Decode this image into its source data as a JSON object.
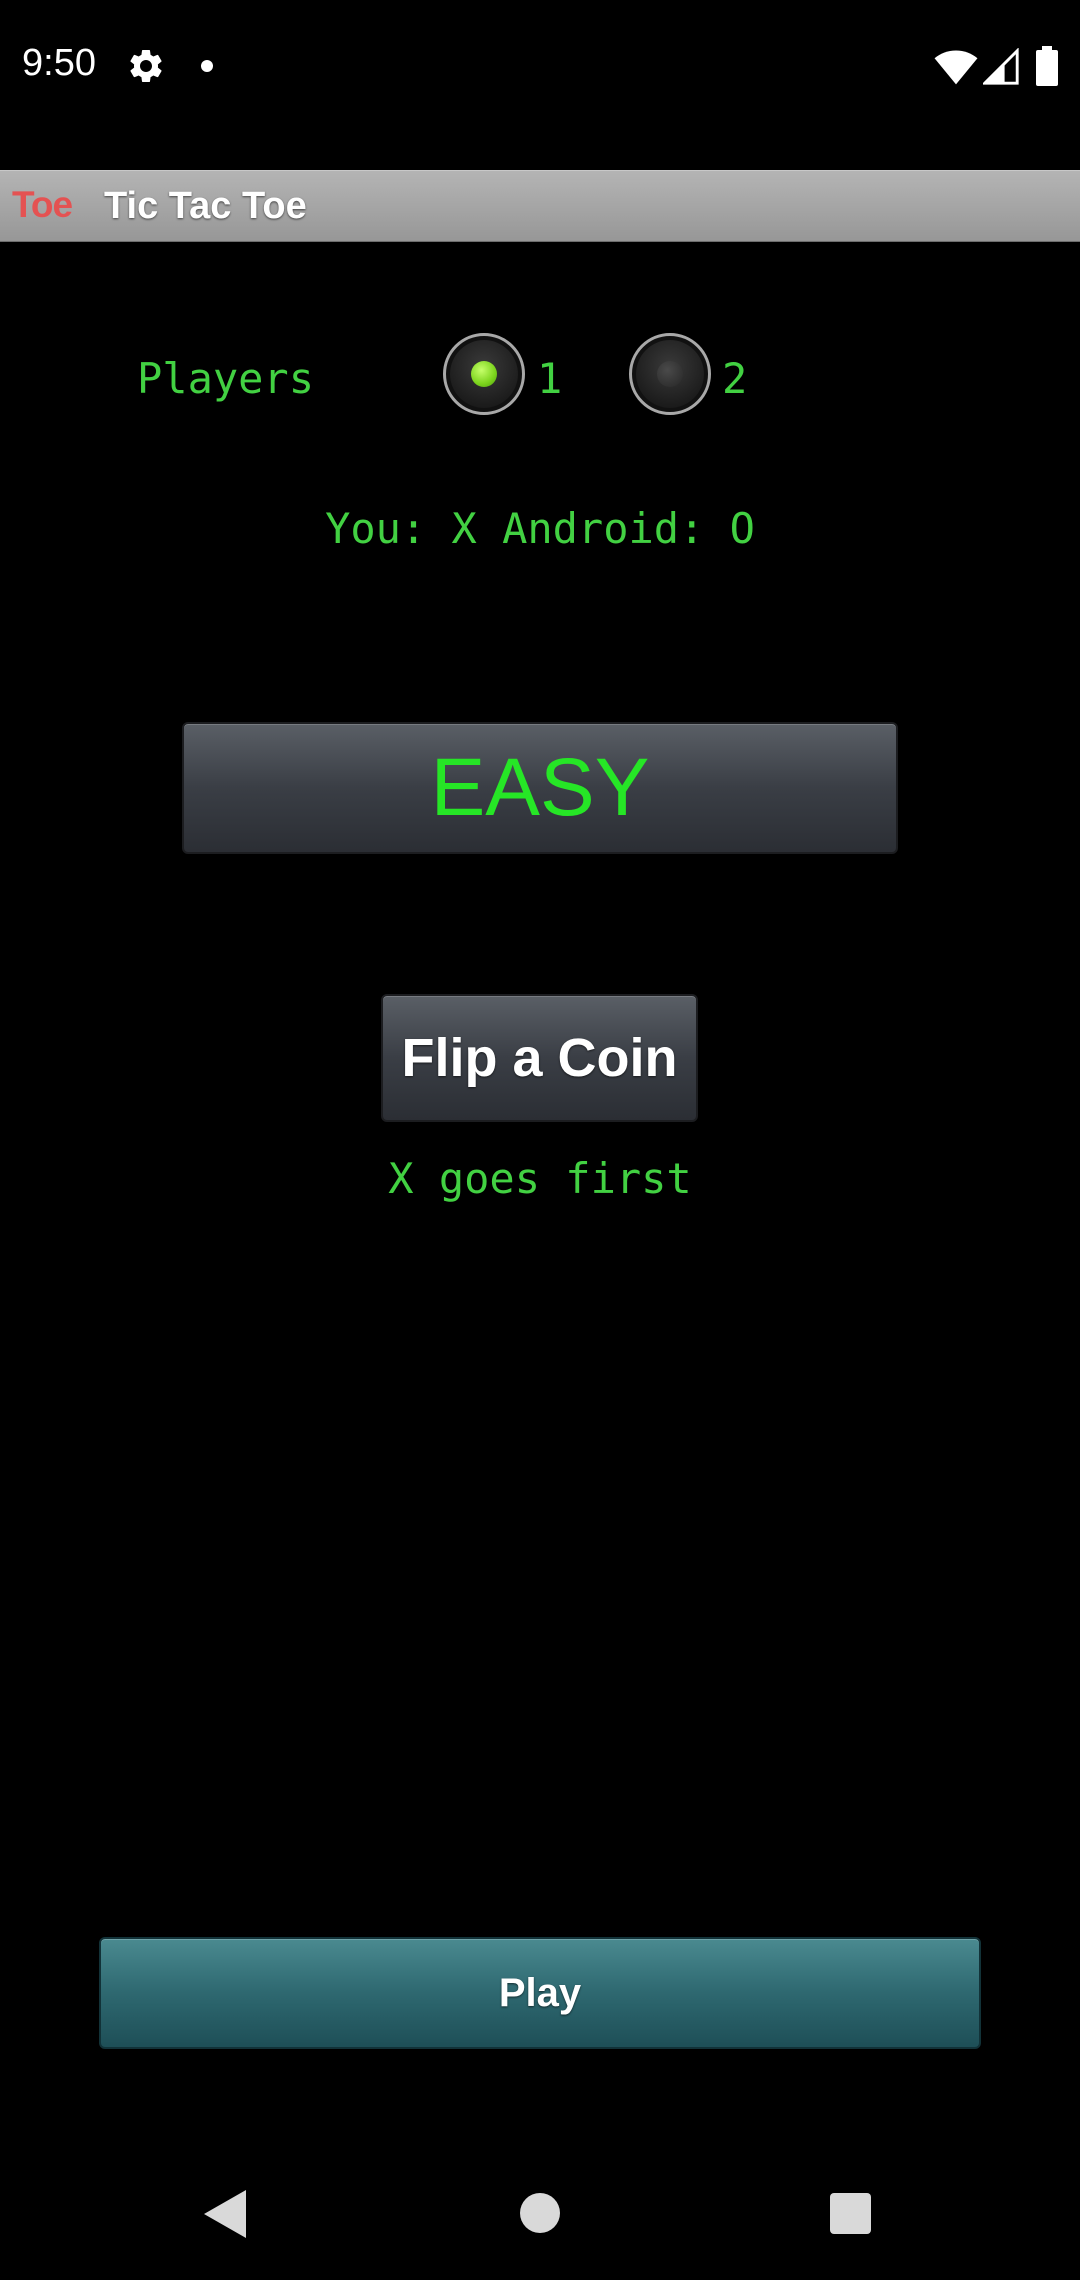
{
  "status_bar": {
    "time": "9:50",
    "icons": [
      "gear-icon",
      "dot-icon",
      "wifi-icon",
      "signal-icon",
      "battery-icon"
    ]
  },
  "title_bar": {
    "logo_text": "Toe",
    "title": "Tic Tac Toe"
  },
  "players": {
    "label": "Players",
    "options": [
      {
        "label": "1",
        "selected": true
      },
      {
        "label": "2",
        "selected": false
      }
    ]
  },
  "matchup_text": "You: X Android: O",
  "difficulty_label": "EASY",
  "flip_coin_label": "Flip a Coin",
  "first_turn_text": "X goes first",
  "play_label": "Play",
  "nav_bar": {
    "icons": [
      "back-icon",
      "home-icon",
      "recents-icon"
    ]
  },
  "colors": {
    "text_green": "#42d142",
    "difficulty_green": "#26e626",
    "logo_red": "#e45252",
    "play_teal": "#2e6870",
    "title_bar_gray": "#a6a6a6"
  }
}
